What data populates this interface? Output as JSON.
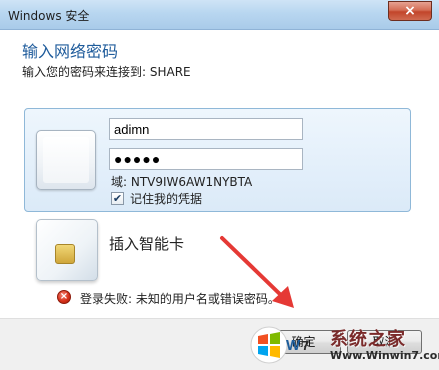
{
  "window": {
    "title": "Windows 安全"
  },
  "header": {
    "title": "输入网络密码",
    "subtitle": "输入您的密码来连接到: SHARE"
  },
  "credentials": {
    "username_value": "adimn",
    "password_value": "●●●●●",
    "domain_text": "域: NTV9IW6AW1NYBTA",
    "remember_label": "记住我的凭据",
    "remember_checked": true
  },
  "smartcard": {
    "label": "插入智能卡"
  },
  "error": {
    "message": "登录失败: 未知的用户名或错误密码。"
  },
  "buttons": {
    "ok_label": "确定",
    "cancel_label": "取消"
  },
  "watermark": {
    "title": "系统之家",
    "url": "Www.Winwin7.com",
    "logo_text": "Win7"
  },
  "icons": {
    "close": "close-icon",
    "user_tile": "user-tile-icon",
    "smartcard": "smartcard-icon",
    "error": "error-icon",
    "checkbox_check": "check-icon"
  },
  "colors": {
    "header_title": "#1e5b9b",
    "error_red": "#d7311a",
    "annotation_arrow": "#e53935"
  }
}
